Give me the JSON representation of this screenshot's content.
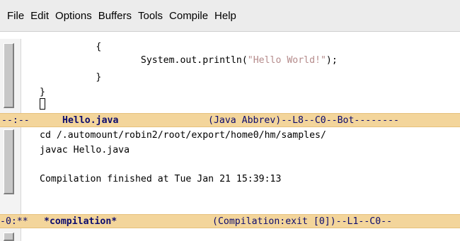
{
  "menu": [
    "File",
    "Edit",
    "Options",
    "Buffers",
    "Tools",
    "Compile",
    "Help"
  ],
  "editor": {
    "lines": [
      "          {",
      "                  System.out.println(",
      "\"Hello World!\"",
      ");",
      "          }",
      "}"
    ]
  },
  "modeline1": {
    "prefix": "--:--",
    "buffer": "Hello.java",
    "info": "(Java Abbrev)--L8--C0--Bot--------"
  },
  "compilation": {
    "lines": [
      "cd /.automount/robin2/root/export/home0/hm/samples/",
      "javac Hello.java",
      "",
      "Compilation finished at Tue Jan 21 15:39:13"
    ]
  },
  "modeline2": {
    "prefix": "-0:**",
    "buffer": "*compilation*",
    "info": "(Compilation:exit [0])--L1--C0--"
  }
}
